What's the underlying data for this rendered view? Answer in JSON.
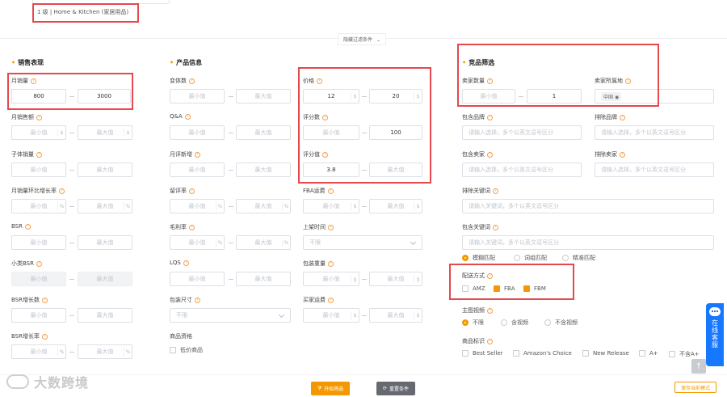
{
  "category": "1 级 | Home & Kitchen (家居用品)",
  "hide_filters": "隐藏过滤条件",
  "sections": {
    "sales": "销售表现",
    "product": "产品信息",
    "competitor": "竞品筛选"
  },
  "ph": {
    "min": "最小值",
    "max": "最大值",
    "unlimited": "不限",
    "multi": "请输入选择，多个以英文逗号区分",
    "keywords": "请输入关键词，多个以英文逗号区分"
  },
  "units": {
    "pct": "%",
    "dollar": "$",
    "gram": "g"
  },
  "sales": {
    "monthly_sales": {
      "label": "月销量",
      "min": "800",
      "max": "3000"
    },
    "monthly_revenue": {
      "label": "月销售额"
    },
    "child_sales": {
      "label": "子体销量"
    },
    "sales_growth": {
      "label": "月销量环比增长率"
    },
    "bsr": {
      "label": "BSR"
    },
    "sub_bsr": {
      "label": "小类BSR"
    },
    "bsr_growth_count": {
      "label": "BSR增长数"
    },
    "bsr_growth_rate": {
      "label": "BSR增长率"
    }
  },
  "product": {
    "variants": {
      "label": "变体数"
    },
    "qa": {
      "label": "Q&A"
    },
    "monthly_new_reviews": {
      "label": "月评新增"
    },
    "return_rate": {
      "label": "留评率"
    },
    "gross_margin": {
      "label": "毛利率"
    },
    "lqs": {
      "label": "LQS"
    },
    "package_size": {
      "label": "包装尺寸",
      "value": "不限"
    },
    "product_qualification": {
      "label": "商品资格",
      "option": "低价商品"
    }
  },
  "price_col": {
    "price": {
      "label": "价格",
      "min": "12",
      "max": "20"
    },
    "review_count": {
      "label": "评分数",
      "max": "100"
    },
    "rating": {
      "label": "评分值",
      "min": "3.8"
    },
    "fba_fee": {
      "label": "FBA运费"
    },
    "listing_time": {
      "label": "上架时间",
      "value": "不限"
    },
    "package_weight": {
      "label": "包装重量"
    },
    "buyer_shipping": {
      "label": "买家运费"
    }
  },
  "competitor": {
    "seller_count": {
      "label": "卖家数量",
      "max": "1"
    },
    "seller_location": {
      "label": "卖家所属地",
      "tag": "中国"
    },
    "include_brand": {
      "label": "包含品牌"
    },
    "exclude_brand": {
      "label": "排除品牌"
    },
    "include_seller": {
      "label": "包含卖家"
    },
    "exclude_seller": {
      "label": "排除卖家"
    },
    "exclude_keywords": {
      "label": "排除关键词"
    },
    "include_keywords": {
      "label": "包含关键词"
    },
    "match_modes": [
      "模糊匹配",
      "词组匹配",
      "精准匹配"
    ],
    "delivery": {
      "label": "配送方式",
      "options": [
        "AMZ",
        "FBA",
        "FBM"
      ]
    },
    "main_video": {
      "label": "主图视频",
      "options": [
        "不限",
        "含视频",
        "不含视频"
      ]
    },
    "product_tags": {
      "label": "商品标识",
      "options": [
        "Best Seller",
        "Amazon's Choice",
        "New Release",
        "A+",
        "不含A+"
      ]
    }
  },
  "footer": {
    "start_filter": "开始筛选",
    "reset": "重置条件",
    "save_mode": "保存当前模式",
    "brand": "大数跨境",
    "online_service": "在线客服"
  },
  "colors": {
    "accent": "#f39800",
    "highlight": "#e5484d",
    "service": "#1677ff"
  }
}
